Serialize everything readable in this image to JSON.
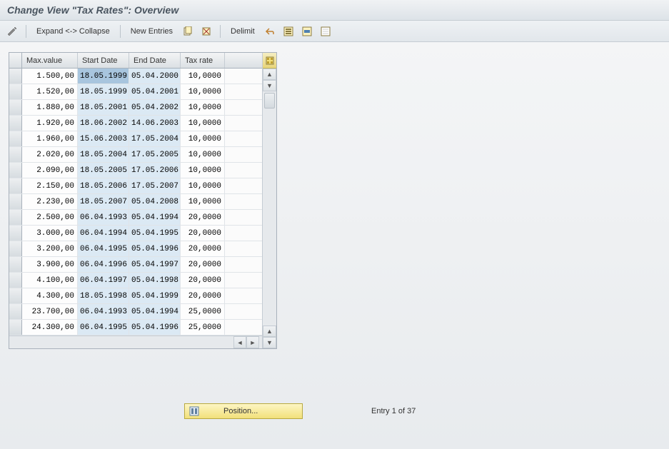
{
  "title": "Change View \"Tax Rates\": Overview",
  "toolbar": {
    "expand_collapse": "Expand <-> Collapse",
    "new_entries": "New Entries",
    "delimit": "Delimit"
  },
  "columns": {
    "max_value": "Max.value",
    "start_date": "Start Date",
    "end_date": "End Date",
    "tax_rate": "Tax rate"
  },
  "rows": [
    {
      "max": "1.500,00",
      "start": "18.05.1999",
      "end": "05.04.2000",
      "rate": "10,0000",
      "hl": true
    },
    {
      "max": "1.520,00",
      "start": "18.05.1999",
      "end": "05.04.2001",
      "rate": "10,0000"
    },
    {
      "max": "1.880,00",
      "start": "18.05.2001",
      "end": "05.04.2002",
      "rate": "10,0000"
    },
    {
      "max": "1.920,00",
      "start": "18.06.2002",
      "end": "14.06.2003",
      "rate": "10,0000"
    },
    {
      "max": "1.960,00",
      "start": "15.06.2003",
      "end": "17.05.2004",
      "rate": "10,0000"
    },
    {
      "max": "2.020,00",
      "start": "18.05.2004",
      "end": "17.05.2005",
      "rate": "10,0000"
    },
    {
      "max": "2.090,00",
      "start": "18.05.2005",
      "end": "17.05.2006",
      "rate": "10,0000"
    },
    {
      "max": "2.150,00",
      "start": "18.05.2006",
      "end": "17.05.2007",
      "rate": "10,0000"
    },
    {
      "max": "2.230,00",
      "start": "18.05.2007",
      "end": "05.04.2008",
      "rate": "10,0000"
    },
    {
      "max": "2.500,00",
      "start": "06.04.1993",
      "end": "05.04.1994",
      "rate": "20,0000"
    },
    {
      "max": "3.000,00",
      "start": "06.04.1994",
      "end": "05.04.1995",
      "rate": "20,0000"
    },
    {
      "max": "3.200,00",
      "start": "06.04.1995",
      "end": "05.04.1996",
      "rate": "20,0000"
    },
    {
      "max": "3.900,00",
      "start": "06.04.1996",
      "end": "05.04.1997",
      "rate": "20,0000"
    },
    {
      "max": "4.100,00",
      "start": "06.04.1997",
      "end": "05.04.1998",
      "rate": "20,0000"
    },
    {
      "max": "4.300,00",
      "start": "18.05.1998",
      "end": "05.04.1999",
      "rate": "20,0000"
    },
    {
      "max": "23.700,00",
      "start": "06.04.1993",
      "end": "05.04.1994",
      "rate": "25,0000"
    },
    {
      "max": "24.300,00",
      "start": "06.04.1995",
      "end": "05.04.1996",
      "rate": "25,0000"
    }
  ],
  "footer": {
    "position": "Position...",
    "entry": "Entry 1 of 37"
  }
}
